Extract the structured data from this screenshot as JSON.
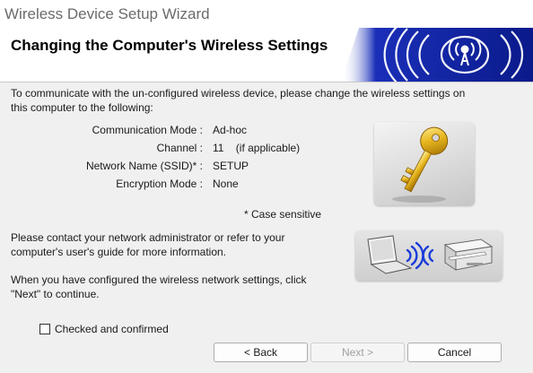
{
  "window": {
    "title": "Wireless Device Setup Wizard"
  },
  "banner": {
    "heading": "Changing the Computer's Wireless Settings"
  },
  "intro": "To communicate with the un-configured wireless device, please change the wireless settings on\nthis computer to the following:",
  "settings": [
    {
      "label": "Communication Mode :",
      "value": "Ad-hoc"
    },
    {
      "label": "Channel :",
      "value": "11    (if applicable)"
    },
    {
      "label": "Network Name (SSID)* :",
      "value": "SETUP"
    },
    {
      "label": "Encryption Mode :",
      "value": "None"
    }
  ],
  "note": "* Case sensitive",
  "contact_text": "Please contact your network administrator or refer to your\ncomputer's user's guide for more information.",
  "next_text": "When you have configured the wireless network settings, click\n\"Next\" to continue.",
  "confirm": {
    "label": "Checked and confirmed",
    "checked": false
  },
  "buttons": {
    "back": "< Back",
    "next": "Next >",
    "cancel": "Cancel"
  },
  "icons": {
    "banner": "wireless-signal-icon",
    "key": "key-icon",
    "devices": "laptop-printer-icon"
  },
  "colors": {
    "banner_blue": "#1a2fb8",
    "key_gold": "#e8b820"
  }
}
